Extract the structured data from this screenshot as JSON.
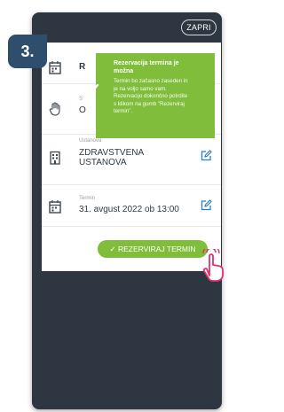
{
  "close_label": "ZAPRI",
  "step_number": "3.",
  "rows": [
    {
      "icon": "calendar-icon",
      "label": "",
      "value": "R"
    },
    {
      "icon": "hand-icon",
      "label": "S",
      "value": "O"
    },
    {
      "icon": "building-icon",
      "label": "Ustanova",
      "value_lines": [
        "ZDRAVSTVENA",
        "USTANOVA"
      ]
    },
    {
      "icon": "calendar-icon",
      "label": "Termin",
      "value": "31. avgust 2022 ob 13:00"
    }
  ],
  "toast": {
    "title_lines": [
      "Rezervacija termina je",
      "možna"
    ],
    "body_lines": [
      "Termin bo začasno zaseden in",
      "je na voljo samo vam.",
      "Rezervacijo dokončno potrdite",
      "s klikom na gumb \"Rezerviraj",
      "termin\"."
    ]
  },
  "reserve_button": "✓ REZERVIRAJ TERMIN",
  "colors": {
    "accent_green": "#7fbd3a",
    "phone_bg": "#2e3641",
    "step_badge": "#2f4d6c",
    "icon_blue": "#2a7fc8",
    "touch_hand": "#e0316a"
  }
}
